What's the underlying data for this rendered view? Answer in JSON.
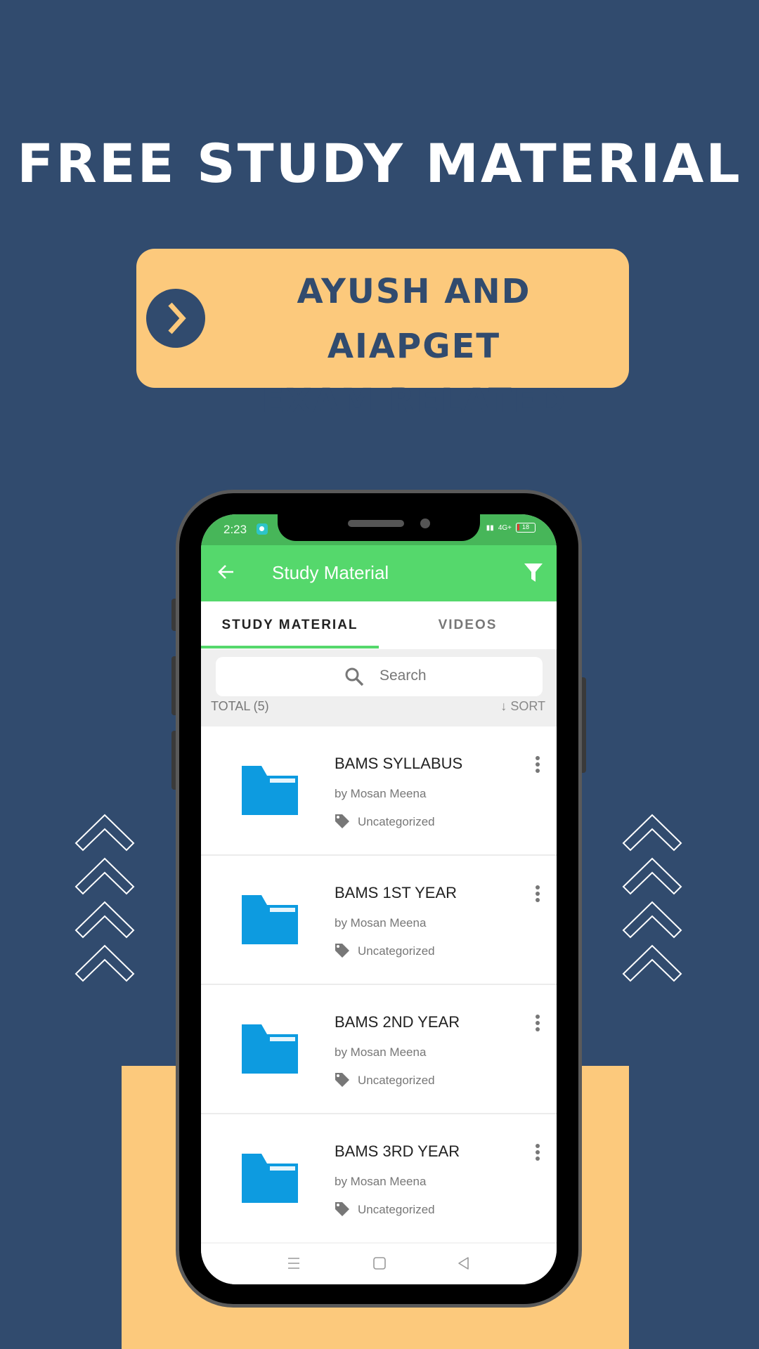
{
  "promo": {
    "headline": "FREE STUDY MATERIAL",
    "banner_line1": "AYUSH AND AIAPGET",
    "banner_line2": "EXAM RELATED",
    "colors": {
      "background": "#314b6e",
      "accent": "#fcc97c",
      "text": "#ffffff"
    }
  },
  "statusbar": {
    "time": "2:23",
    "network": "4G+",
    "battery": "18"
  },
  "appbar": {
    "title": "Study Material",
    "back_icon": "arrow-left-icon",
    "filter_icon": "filter-icon",
    "color": "#55d86c"
  },
  "tabs": [
    {
      "label": "STUDY MATERIAL",
      "active": true
    },
    {
      "label": "VIDEOS",
      "active": false
    }
  ],
  "search": {
    "placeholder": "Search"
  },
  "list_header": {
    "total": "TOTAL (5)",
    "sort": "↓ SORT"
  },
  "items": [
    {
      "title": "BAMS SYLLABUS",
      "author": "by Mosan Meena",
      "tag": "Uncategorized"
    },
    {
      "title": "BAMS 1ST YEAR",
      "author": "by Mosan Meena",
      "tag": "Uncategorized"
    },
    {
      "title": "BAMS 2ND YEAR",
      "author": "by Mosan Meena",
      "tag": "Uncategorized"
    },
    {
      "title": "BAMS 3RD YEAR",
      "author": "by Mosan Meena",
      "tag": "Uncategorized"
    }
  ],
  "navbar": {
    "recents": "menu-icon",
    "home": "square-icon",
    "back": "triangle-back-icon"
  }
}
